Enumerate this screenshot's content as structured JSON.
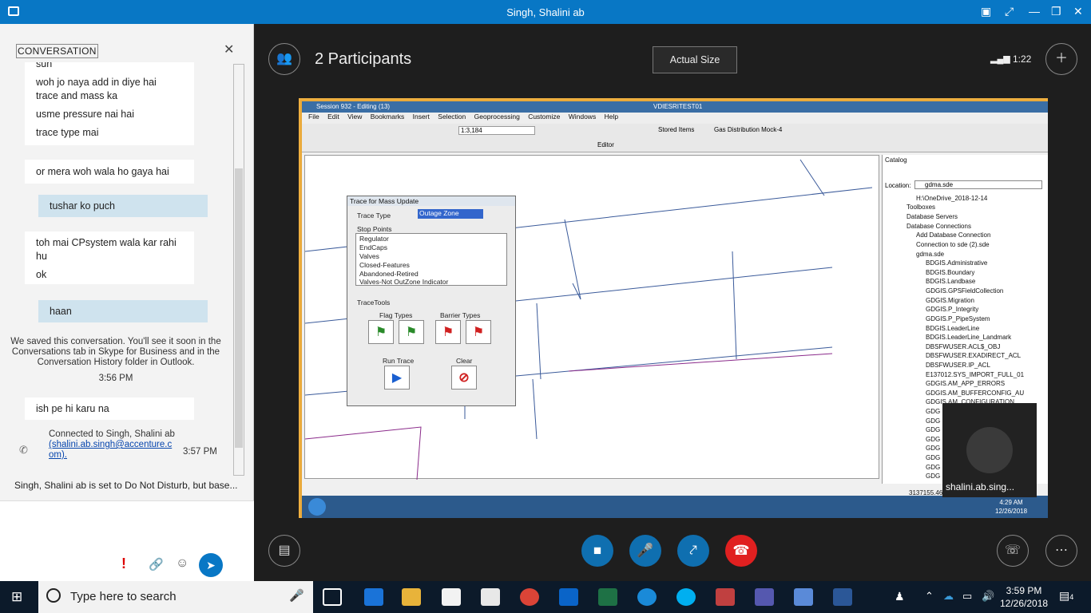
{
  "window": {
    "title": "Singh, Shalini ab"
  },
  "chat": {
    "header": "CONVERSATION",
    "messages": [
      {
        "lines": [
          "sun"
        ]
      },
      {
        "lines": [
          "woh jo naya add in diye hai",
          "trace and mass ka"
        ]
      },
      {
        "lines": [
          "usme pressure nai hai"
        ]
      },
      {
        "lines": [
          "trace type mai"
        ]
      },
      {
        "lines": [
          "or mera woh wala ho gaya hai"
        ]
      },
      {
        "mine": "tushar ko puch"
      },
      {
        "lines": [
          "toh mai CPsystem wala kar rahi",
          "hu"
        ]
      },
      {
        "lines": [
          "ok"
        ]
      },
      {
        "mine": "haan"
      }
    ],
    "saved_notice": "We saved this conversation. You'll see it soon in the Conversations tab in Skype for Business and in the Conversation History folder in Outlook.",
    "saved_time": "3:56 PM",
    "last_message": "ish pe hi karu na",
    "connected_text": "Connected to Singh, Shalini ab",
    "connected_email": "shalini.ab.singh@accenture.com",
    "connected_email_display": "(shalini.ab.singh@accenture.c om).",
    "connected_time": "3:57 PM",
    "dnd_status": "Singh, Shalini ab is set to Do Not Disturb, but base..."
  },
  "meeting": {
    "participants": "2 Participants",
    "actual_size": "Actual Size",
    "duration": "1:22",
    "video_name": "shalini.ab.sing..."
  },
  "shared": {
    "session_title": "Session 932 - Editing (13)",
    "rdp_title": "VDIESRITEST01",
    "menus": [
      "File",
      "Edit",
      "View",
      "Bookmarks",
      "Insert",
      "Selection",
      "Geoprocessing",
      "Customize",
      "Windows",
      "Help"
    ],
    "scale": "1:3,184",
    "stored_items": "Stored Items",
    "gas_dist": "Gas Distribution Mock-4",
    "editor": "Editor",
    "dialog": {
      "title": "Trace for Mass Update",
      "trace_type_label": "Trace Type",
      "trace_type_value": "Outage Zone",
      "stop_points_label": "Stop Points",
      "stop_points": [
        "Regulator",
        "EndCaps",
        "Valves",
        "Closed-Features",
        "Abandoned-Retired",
        "Valves-Not OutZone Indicator"
      ],
      "trace_tools": "TraceTools",
      "flag_types": "Flag Types",
      "barrier_types": "Barrier Types",
      "run_trace": "Run Trace",
      "clear": "Clear"
    },
    "catalog": {
      "title": "Catalog",
      "location_label": "Location:",
      "location_value": "gdma.sde",
      "items": [
        "H:\\OneDrive_2018-12-14",
        "Toolboxes",
        "Database Servers",
        "Database Connections",
        "Add Database Connection",
        "Connection to sde (2).sde",
        "gdma.sde",
        "BDGIS.Administrative",
        "BDGIS.Boundary",
        "BDGIS.Landbase",
        "GDGIS.GPSFieldCollection",
        "GDGIS.Migration",
        "GDGIS.P_Integrity",
        "GDGIS.P_PipeSystem",
        "BDGIS.LeaderLine",
        "BDGIS.LeaderLine_Landmark",
        "DBSFWUSER.ACL$_OBJ",
        "DBSFWUSER.EXADIRECT_ACL",
        "DBSFWUSER.IP_ACL",
        "E137012.SYS_IMPORT_FULL_01",
        "GDGIS.AM_APP_ERRORS",
        "GDGIS.AM_BUFFERCONFIG_AU",
        "GDGIS.AM_CONFIGURATION",
        "GDG",
        "GDG",
        "GDG",
        "GDG",
        "GDG",
        "GDG",
        "GDG",
        "GDG"
      ]
    },
    "coords": "3137155.46",
    "rdp_time": "4:29 AM",
    "rdp_date": "12/26/2018"
  },
  "taskbar": {
    "search_placeholder": "Type here to search",
    "time": "3:59 PM",
    "date": "12/26/2018",
    "notifications": "4"
  }
}
